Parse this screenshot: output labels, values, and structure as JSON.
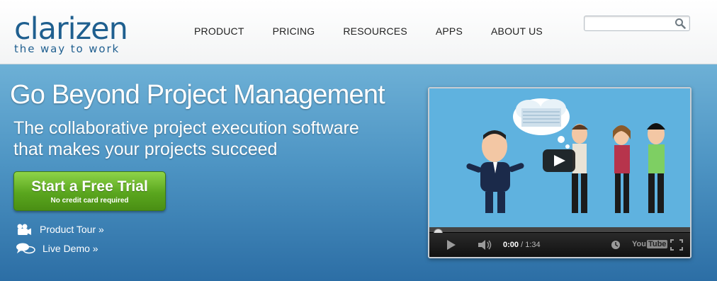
{
  "brand": {
    "name": "clarizen",
    "tagline": "the way to work",
    "color": "#1f5f8f"
  },
  "nav": {
    "items": [
      "PRODUCT",
      "PRICING",
      "RESOURCES",
      "APPS",
      "ABOUT US"
    ]
  },
  "search": {
    "placeholder": "",
    "icon": "search-icon"
  },
  "hero": {
    "title": "Go Beyond Project Management",
    "subtitle_line1": "The collaborative project execution software",
    "subtitle_line2": "that makes your projects succeed",
    "cta": {
      "label": "Start a Free Trial",
      "sublabel": "No credit card required",
      "color": "#5aa61e"
    },
    "links": {
      "tour": "Product Tour »",
      "demo": "Live Demo »"
    }
  },
  "video": {
    "current_time": "0:00",
    "duration": "/ 1:34",
    "progress": 0,
    "player_brand": "You",
    "player_brand_box": "Tube"
  }
}
